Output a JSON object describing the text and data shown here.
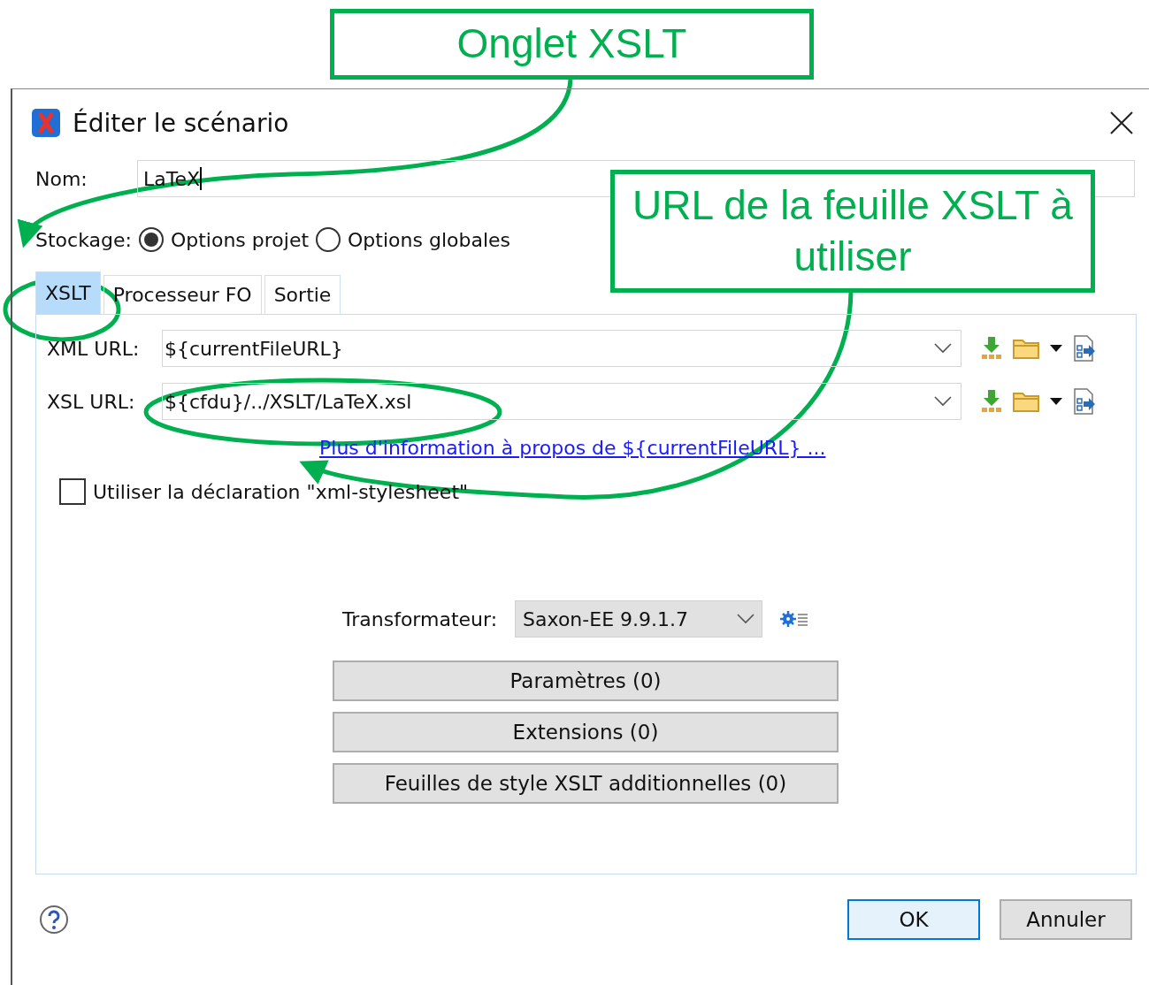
{
  "callouts": [
    {
      "text": "Onglet XSLT"
    },
    {
      "text": "URL de la feuille XSLT à utiliser"
    }
  ],
  "dialog": {
    "title": "Éditer le scénario",
    "name": {
      "label": "Nom:",
      "value": "LaTeX"
    },
    "storage": {
      "label": "Stockage:",
      "options": [
        {
          "label": "Options projet",
          "selected": true
        },
        {
          "label": "Options globales",
          "selected": false
        }
      ]
    },
    "tabs": [
      {
        "label": "XSLT",
        "selected": true
      },
      {
        "label": "Processeur FO",
        "selected": false
      },
      {
        "label": "Sortie",
        "selected": false
      }
    ],
    "url_fields": [
      {
        "label": "XML URL:",
        "value": "${currentFileURL}"
      },
      {
        "label": "XSL URL:",
        "value": "${cfdu}/../XSLT/LaTeX.xsl"
      }
    ],
    "info_link": "Plus d'information à propos de ${currentFileURL} ...",
    "checkbox": {
      "label": "Utiliser la déclaration \"xml-stylesheet\"",
      "checked": false
    },
    "transformer": {
      "label": "Transformateur:",
      "value": "Saxon-EE 9.9.1.7"
    },
    "buttons": [
      "Paramètres (0)",
      "Extensions (0)",
      "Feuilles de style XSLT additionnelles (0)"
    ],
    "footer_buttons": [
      {
        "label": "OK",
        "kind": "default"
      },
      {
        "label": "Annuler",
        "kind": "normal"
      }
    ]
  }
}
